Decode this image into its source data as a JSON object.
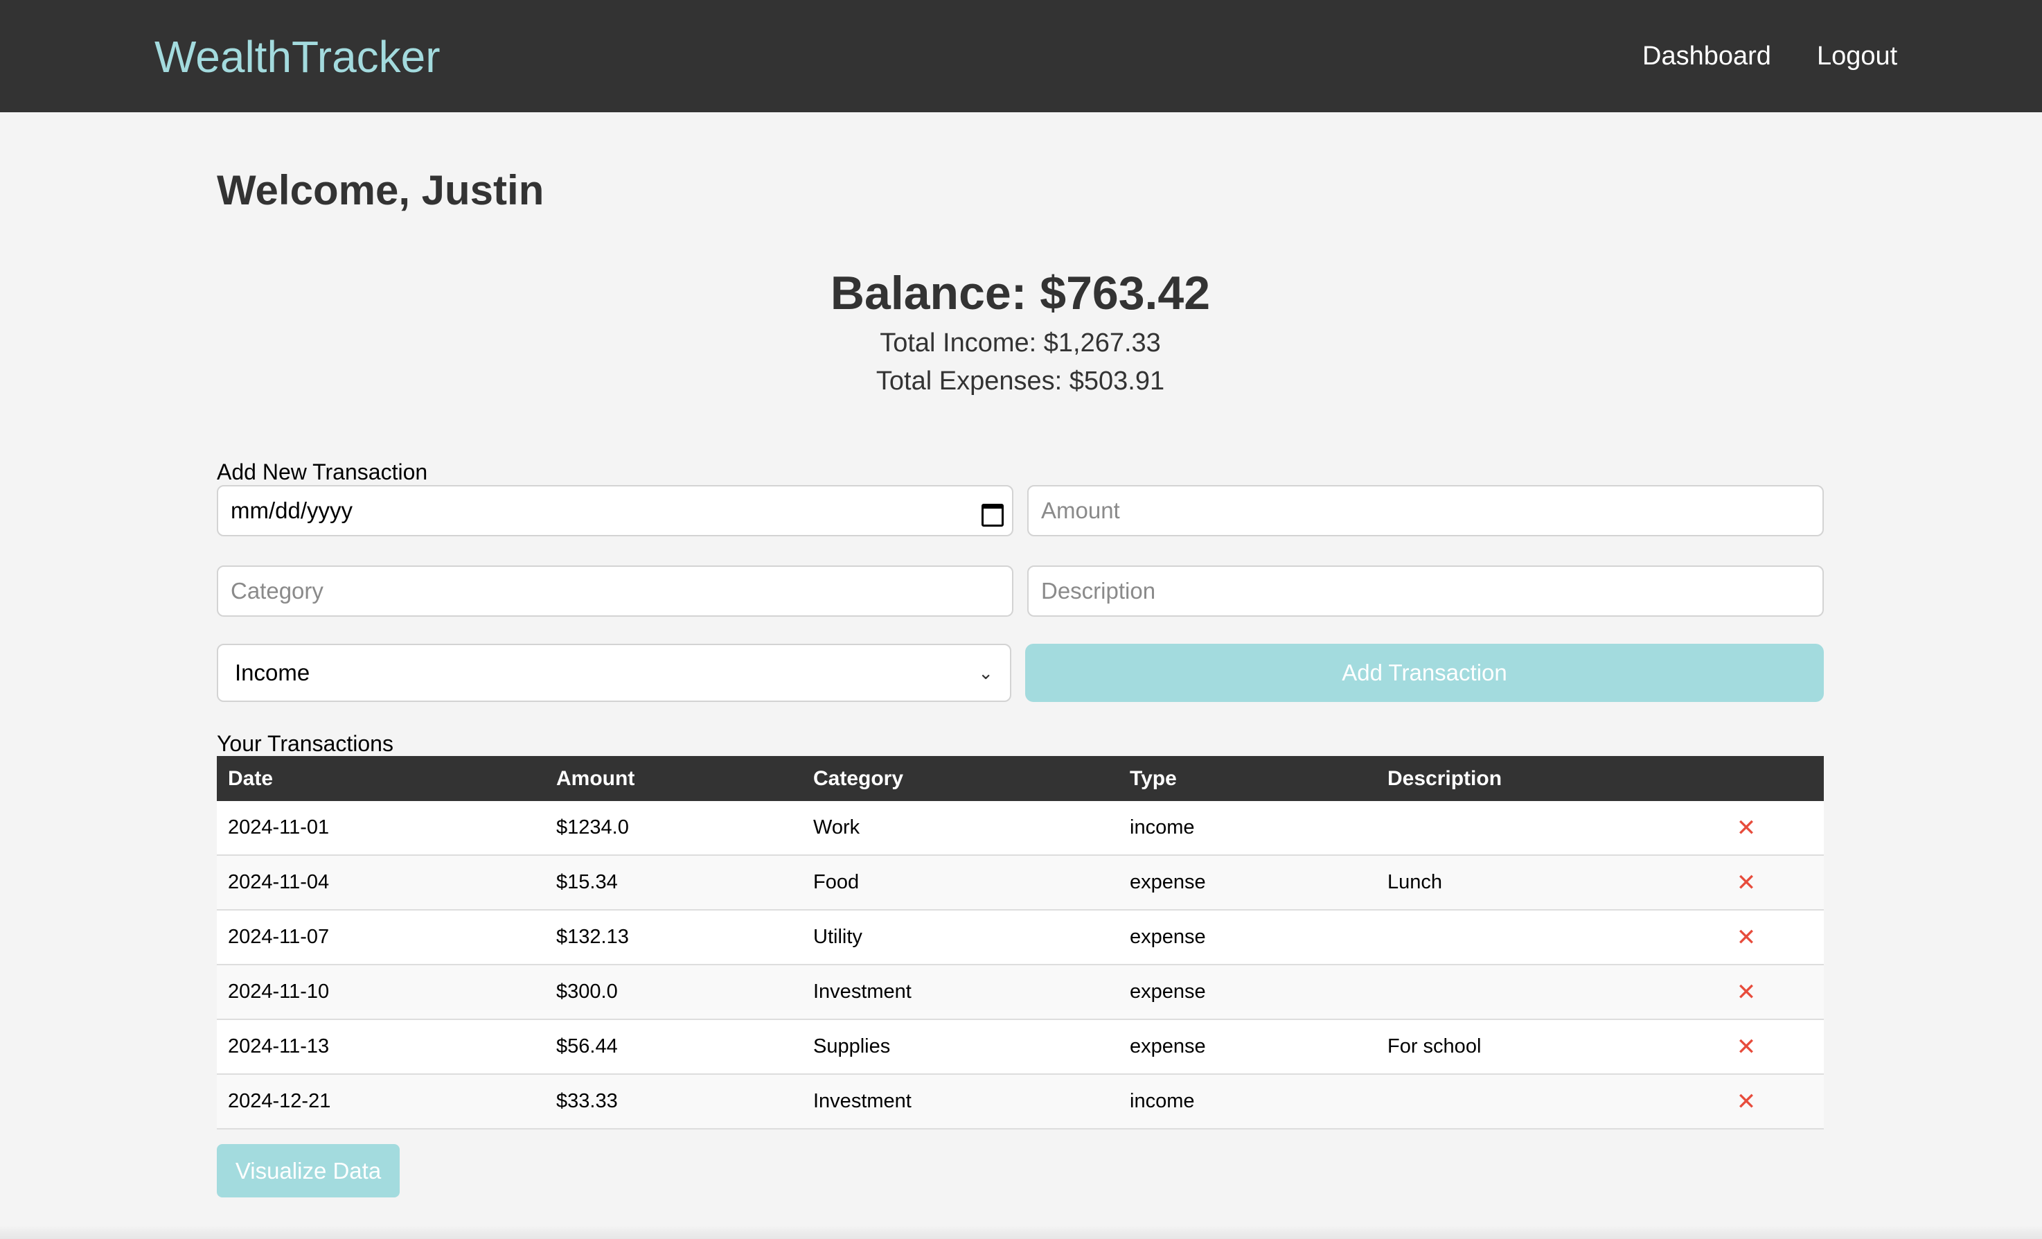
{
  "nav": {
    "brand": "WealthTracker",
    "links": [
      "Dashboard",
      "Logout"
    ]
  },
  "welcome": "Welcome, Justin",
  "summary": {
    "balance": "Balance: $763.42",
    "total_income": "Total Income: $1,267.33",
    "total_expenses": "Total Expenses: $503.91"
  },
  "form": {
    "section_label": "Add New Transaction",
    "date_value": "mm/dd/yyyy",
    "amount_placeholder": "Amount",
    "category_placeholder": "Category",
    "description_placeholder": "Description",
    "type_selected": "Income",
    "submit_label": "Add Transaction"
  },
  "transactions": {
    "section_label": "Your Transactions",
    "headers": [
      "Date",
      "Amount",
      "Category",
      "Type",
      "Description"
    ],
    "rows": [
      {
        "date": "2024-11-01",
        "amount": "$1234.0",
        "category": "Work",
        "type": "income",
        "description": ""
      },
      {
        "date": "2024-11-04",
        "amount": "$15.34",
        "category": "Food",
        "type": "expense",
        "description": "Lunch"
      },
      {
        "date": "2024-11-07",
        "amount": "$132.13",
        "category": "Utility",
        "type": "expense",
        "description": ""
      },
      {
        "date": "2024-11-10",
        "amount": "$300.0",
        "category": "Investment",
        "type": "expense",
        "description": ""
      },
      {
        "date": "2024-11-13",
        "amount": "$56.44",
        "category": "Supplies",
        "type": "expense",
        "description": "For school"
      },
      {
        "date": "2024-12-21",
        "amount": "$33.33",
        "category": "Investment",
        "type": "income",
        "description": ""
      }
    ],
    "delete_glyph": "✕"
  },
  "visualize_label": "Visualize Data",
  "colors": {
    "navbar": "#333333",
    "brand": "#a3dbde",
    "button": "#a3dbde",
    "delete": "#e74c3c",
    "background": "#f4f4f4"
  }
}
